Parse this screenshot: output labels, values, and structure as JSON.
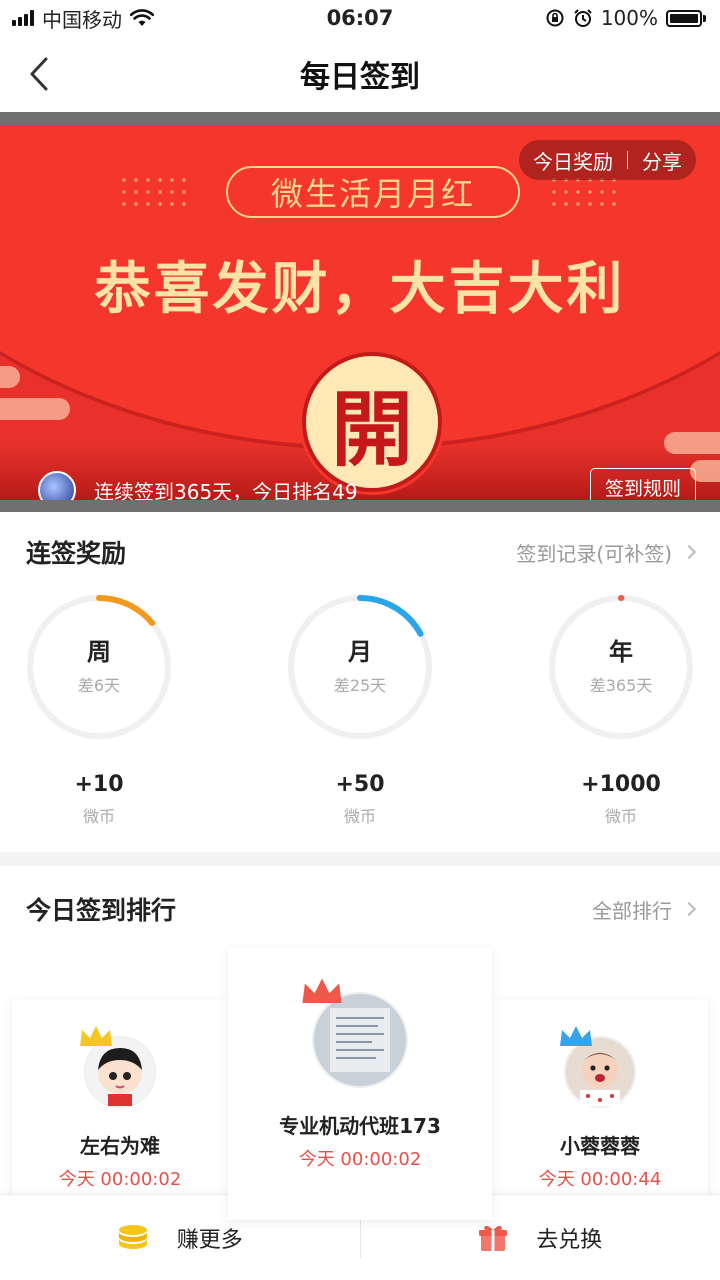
{
  "status": {
    "carrier": "中国移动",
    "time": "06:07",
    "battery": "100%"
  },
  "nav": {
    "title": "每日签到"
  },
  "banner": {
    "pill_title": "微生活月月红",
    "slogan": "恭喜发财，大吉大利",
    "today_reward": "今日奖励",
    "share": "分享",
    "open_char": "開",
    "streak_text": "连续签到365天，今日排名49",
    "rule_button": "签到规则"
  },
  "rewards": {
    "title": "连签奖励",
    "link": "签到记录(可补签)",
    "items": [
      {
        "label": "周",
        "remaining": "差6天",
        "amount": "+10",
        "unit": "微币",
        "color": "#f39a1e",
        "progress": 0.14
      },
      {
        "label": "月",
        "remaining": "差25天",
        "amount": "+50",
        "unit": "微币",
        "color": "#2aa6e8",
        "progress": 0.17
      },
      {
        "label": "年",
        "remaining": "差365天",
        "amount": "+1000",
        "unit": "微币",
        "color": "#f0584a",
        "progress": 0.0
      }
    ]
  },
  "ranking": {
    "title": "今日签到排行",
    "link": "全部排行",
    "entries": [
      {
        "name": "专业机动代班173",
        "time": "今天 00:00:02",
        "rank": 1
      },
      {
        "name": "左右为难",
        "time": "今天 00:00:02",
        "rank": 2
      },
      {
        "name": "小蓉蓉蓉",
        "time": "今天 00:00:44",
        "rank": 3
      }
    ]
  },
  "tabs": {
    "earn": "赚更多",
    "exchange": "去兑换"
  }
}
